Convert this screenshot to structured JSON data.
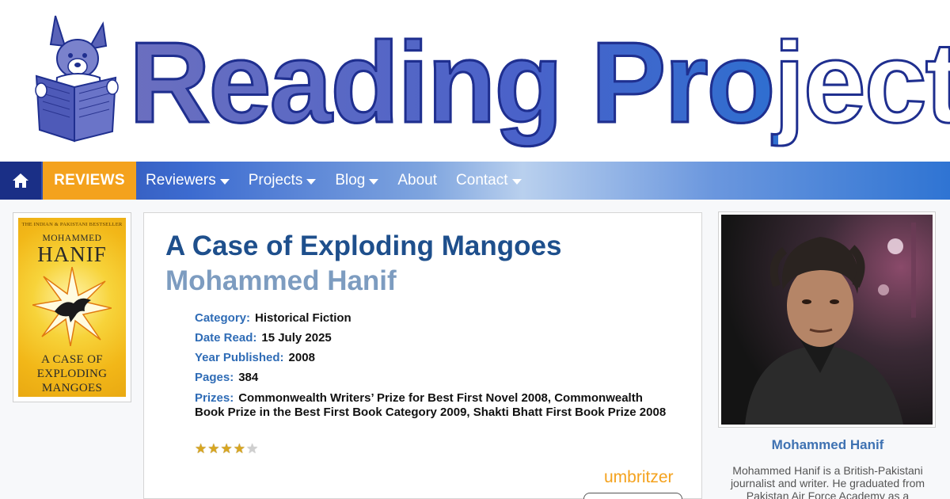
{
  "site": {
    "logo_text": "Reading Project"
  },
  "nav": {
    "home_icon": "home-icon",
    "reviews": "REVIEWS",
    "items": [
      {
        "label": "Reviewers",
        "has_caret": true
      },
      {
        "label": "Projects",
        "has_caret": true
      },
      {
        "label": "Blog",
        "has_caret": true
      },
      {
        "label": "About",
        "has_caret": false
      },
      {
        "label": "Contact",
        "has_caret": true
      }
    ]
  },
  "cover": {
    "tagline": "THE INDIAN & PAKISTANI BESTSELLER",
    "author_first": "MOHAMMED",
    "author_last": "HANIF",
    "title_lines": [
      "A CASE OF",
      "EXPLODING",
      "MANGOES"
    ]
  },
  "book": {
    "title": "A Case of Exploding Mangoes",
    "author": "Mohammed Hanif",
    "meta": [
      {
        "label": "Category:",
        "value": "Historical Fiction"
      },
      {
        "label": "Date Read:",
        "value": "15 July 2025"
      },
      {
        "label": "Year Published:",
        "value": "2008"
      },
      {
        "label": "Pages:",
        "value": "384"
      }
    ],
    "prizes_label": "Prizes:",
    "prizes_value": "Commonwealth Writers’ Prize for Best First Novel 2008, Commonwealth Book Prize in the Best First Book Category 2009, Shakti Bhatt First Book Prize 2008",
    "rating": 4,
    "rating_max": 5,
    "reviewer": "umbritzer"
  },
  "author_panel": {
    "name": "Mohammed Hanif",
    "bio": "Mohammed Hanif is a British-Pakistani journalist and writer. He graduated from Pakistan Air Force Academy as a"
  },
  "colors": {
    "nav_dark": "#1a2f86",
    "reviews_orange": "#f4a21d",
    "title_blue": "#1e4f8c",
    "author_blue": "#7d9cc0",
    "label_blue": "#2f6cb6"
  }
}
